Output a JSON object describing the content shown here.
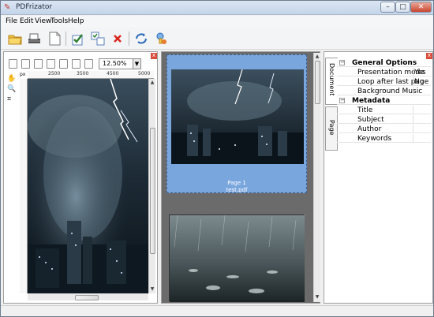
{
  "window": {
    "title": "PDFrizator"
  },
  "menu": [
    "File",
    "Edit",
    "View",
    "Tools",
    "Help"
  ],
  "toolbar_icons": [
    "open-folder-icon",
    "scanner-icon",
    "new-page-icon",
    "check-pages-icon",
    "arrange-pages-icon",
    "delete-icon",
    "refresh-icon",
    "settings-icon"
  ],
  "viewer": {
    "zoom": "12.50%",
    "ruler_unit": "px",
    "ruler_ticks": [
      "2500",
      "3500",
      "4500",
      "5000"
    ]
  },
  "pages": [
    {
      "label": "Page 1",
      "file": "test.pdf",
      "selected": true
    },
    {
      "label": "",
      "file": "",
      "selected": false
    }
  ],
  "side_tabs": {
    "document": "Document",
    "page": "Page"
  },
  "properties": {
    "general_header": "General Options",
    "rows": [
      {
        "key": "Presentation mode",
        "value": "Yes"
      },
      {
        "key": "Loop after last page",
        "value": "No"
      },
      {
        "key": "Background Music",
        "value": ""
      }
    ],
    "metadata_header": "Metadata",
    "meta_rows": [
      {
        "key": "Title",
        "value": ""
      },
      {
        "key": "Subject",
        "value": ""
      },
      {
        "key": "Author",
        "value": ""
      },
      {
        "key": "Keywords",
        "value": ""
      }
    ]
  },
  "colors": {
    "selection": "#7aa6de",
    "panel_border": "#a0a0a0",
    "close_red": "#d94d3a"
  }
}
